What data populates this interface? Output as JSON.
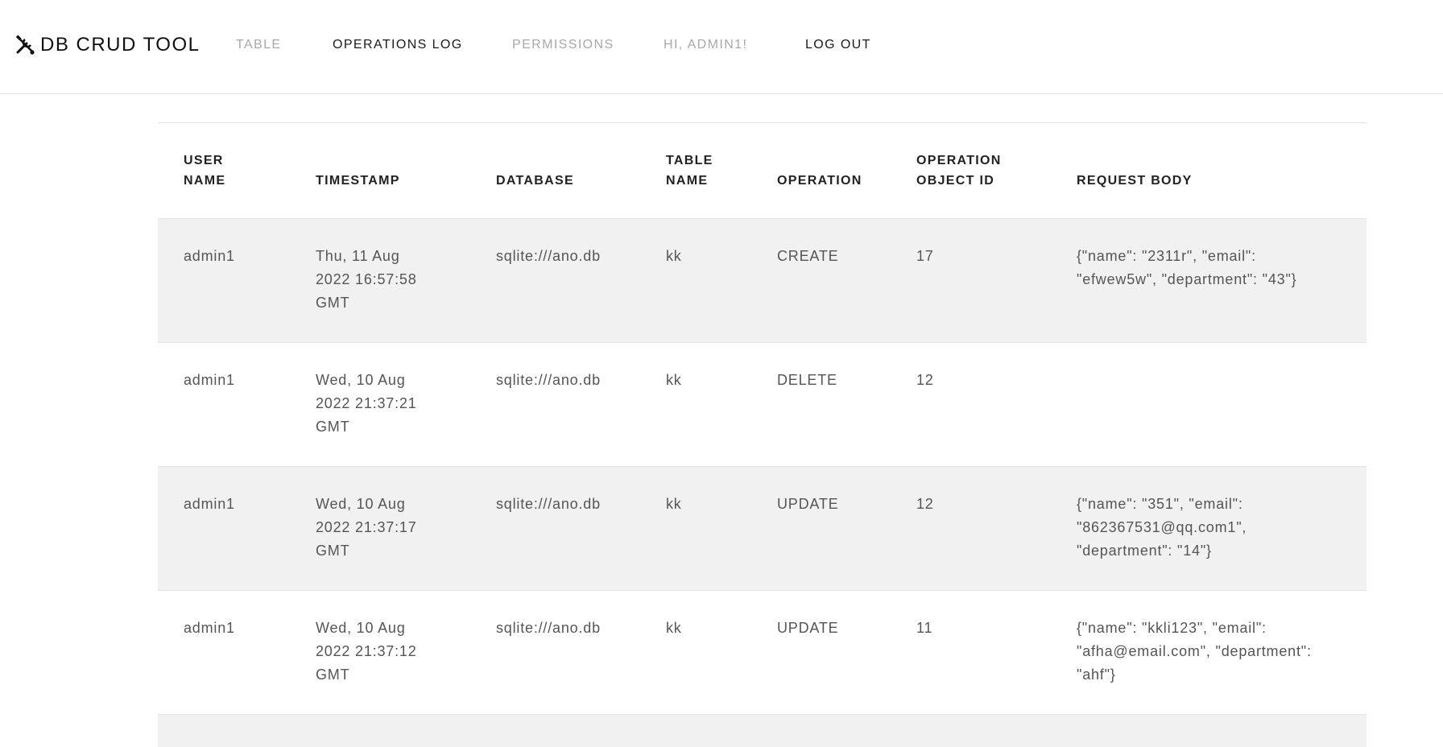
{
  "navbar": {
    "brand": "DB CRUD TOOL",
    "links": {
      "table": "TABLE",
      "operations_log": "OPERATIONS LOG",
      "permissions": "PERMISSIONS",
      "greeting": "HI, ADMIN1!",
      "logout": "LOG OUT"
    }
  },
  "table": {
    "headers": {
      "user_name": [
        "USER",
        "NAME"
      ],
      "timestamp": "TIMESTAMP",
      "database": "DATABASE",
      "table_name": [
        "TABLE",
        "NAME"
      ],
      "operation": "OPERATION",
      "object_id": [
        "OPERATION",
        "OBJECT ID"
      ],
      "request_body": "REQUEST BODY"
    },
    "rows": [
      {
        "user": "admin1",
        "timestamp": [
          "Thu, 11 Aug",
          "2022 16:57:58",
          "GMT"
        ],
        "database": "sqlite:///ano.db",
        "table_name": "kk",
        "operation": "CREATE",
        "object_id": "17",
        "request_body": [
          "{\"name\": \"2311r\", \"email\":",
          "\"efwew5w\", \"department\": \"43\"}"
        ]
      },
      {
        "user": "admin1",
        "timestamp": [
          "Wed, 10 Aug",
          "2022 21:37:21",
          "GMT"
        ],
        "database": "sqlite:///ano.db",
        "table_name": "kk",
        "operation": "DELETE",
        "object_id": "12",
        "request_body": []
      },
      {
        "user": "admin1",
        "timestamp": [
          "Wed, 10 Aug",
          "2022 21:37:17",
          "GMT"
        ],
        "database": "sqlite:///ano.db",
        "table_name": "kk",
        "operation": "UPDATE",
        "object_id": "12",
        "request_body": [
          "{\"name\": \"351\", \"email\":",
          "\"862367531@qq.com1\",",
          "\"department\": \"14\"}"
        ]
      },
      {
        "user": "admin1",
        "timestamp": [
          "Wed, 10 Aug",
          "2022 21:37:12",
          "GMT"
        ],
        "database": "sqlite:///ano.db",
        "table_name": "kk",
        "operation": "UPDATE",
        "object_id": "11",
        "request_body": [
          "{\"name\": \"kkli123\", \"email\":",
          "\"afha@email.com\", \"department\":",
          "\"ahf\"}"
        ]
      }
    ]
  }
}
